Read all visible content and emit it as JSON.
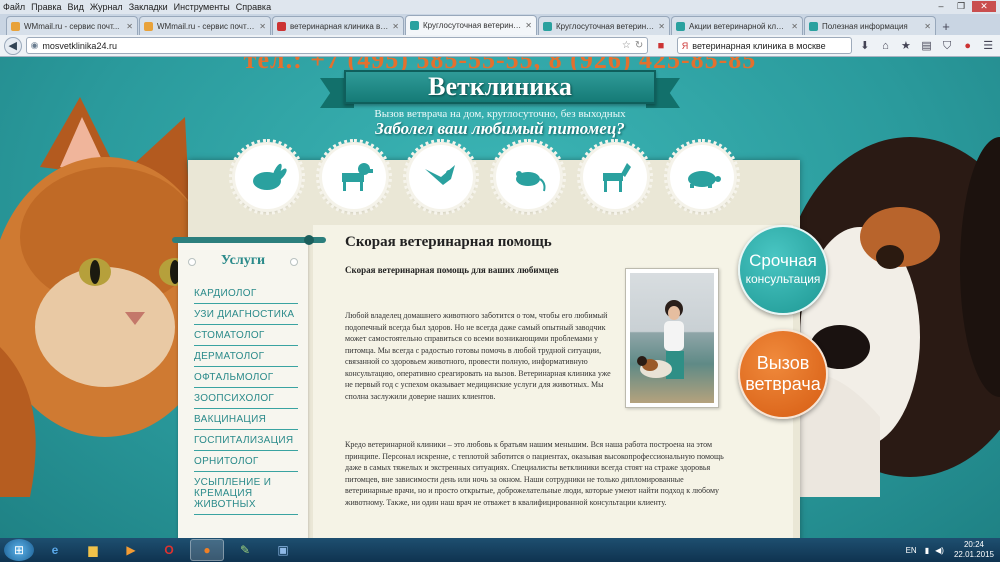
{
  "browser": {
    "menu": [
      "Файл",
      "Правка",
      "Вид",
      "Журнал",
      "Закладки",
      "Инструменты",
      "Справка"
    ],
    "tabs": [
      {
        "label": "WMmail.ru - сервис почт...",
        "color": "#e8a23a",
        "active": false
      },
      {
        "label": "WMmail.ru - сервис почтов...",
        "color": "#e8a23a",
        "active": false
      },
      {
        "label": "ветеринарная клиника в м...",
        "color": "#cc3333",
        "active": false
      },
      {
        "label": "Круглосуточная ветерина...",
        "color": "#2aa19f",
        "active": true
      },
      {
        "label": "Круглосуточная ветерина...",
        "color": "#2aa19f",
        "active": false
      },
      {
        "label": "Акции ветеринарной клини...",
        "color": "#2aa19f",
        "active": false
      },
      {
        "label": "Полезная информация",
        "color": "#2aa19f",
        "active": false
      }
    ],
    "url": "mosvetklinika24.ru",
    "search_value": "ветеринарная клиника в москве"
  },
  "page": {
    "phone_header": "тел.: +7 (495) 585-55-55, 8 (926) 425-85-85",
    "site_title": "Ветклиника",
    "tagline": "Вызов ветврача на дом, круглосуточно, без выходных",
    "headline": "Заболел ваш любимый питомец?",
    "badges": [
      "rabbit-icon",
      "dog-icon",
      "bird-icon",
      "rat-icon",
      "horse-icon",
      "turtle-icon"
    ],
    "sidebar": {
      "title": "Услуги",
      "items": [
        "Кардиолог",
        "УЗИ диагностика",
        "Стоматолог",
        "Дерматолог",
        "Офтальмолог",
        "Зоопсихолог",
        "Вакцинация",
        "Госпитализация",
        "Орнитолог",
        "Усыпление и кремация животных"
      ]
    },
    "article": {
      "title": "Скорая ветеринарная помощь",
      "subtitle": "Скорая ветеринарная помощь для ваших любимцев",
      "para1": "Любой владелец домашнего животного заботится о том, чтобы его любимый подопечный всегда был здоров. Но не всегда даже самый опытный заводчик может самостоятельно справиться со всеми возникающими проблемами у питомца. Мы всегда с радостью готовы помочь в любой трудной ситуации, связанной со здоровьем животного, провести полную, информативную консультацию, оперативно среагировать на вызов. Ветеринарная клиника уже не первый год с успехом оказывает медицинские услуги для животных. Мы сполна заслужили доверие наших клиентов.",
      "para2": "Кредо ветеринарной клиники – это любовь к братьям нашим меньшим. Вся наша работа построена на этом принципе. Персонал искренне, с теплотой заботится о пациентах, оказывая высокопрофессиональную помощь даже в самых тяжелых и экстренных ситуациях. Специалисты ветклиники всегда стоят на страже здоровья питомцев, вне зависимости день или ночь за окном. Наши сотрудники не только дипломированные ветеринарные врачи, но и просто открытые, доброжелательные люди, которые умеют найти подход к любому животному. Также, ни один наш врач не отважет в квалифицированной консультации клиенту."
    },
    "cta_urgent": {
      "line1": "Срочная",
      "line2": "консультация"
    },
    "cta_vet": {
      "line1": "Вызов",
      "line2": "ветврача"
    }
  },
  "taskbar": {
    "apps": [
      "ie-icon",
      "explorer-icon",
      "media-player-icon",
      "opera-icon",
      "firefox-icon",
      "notepad-icon",
      "app-icon"
    ],
    "lang": "EN",
    "time": "20:24",
    "date": "22.01.2015"
  }
}
